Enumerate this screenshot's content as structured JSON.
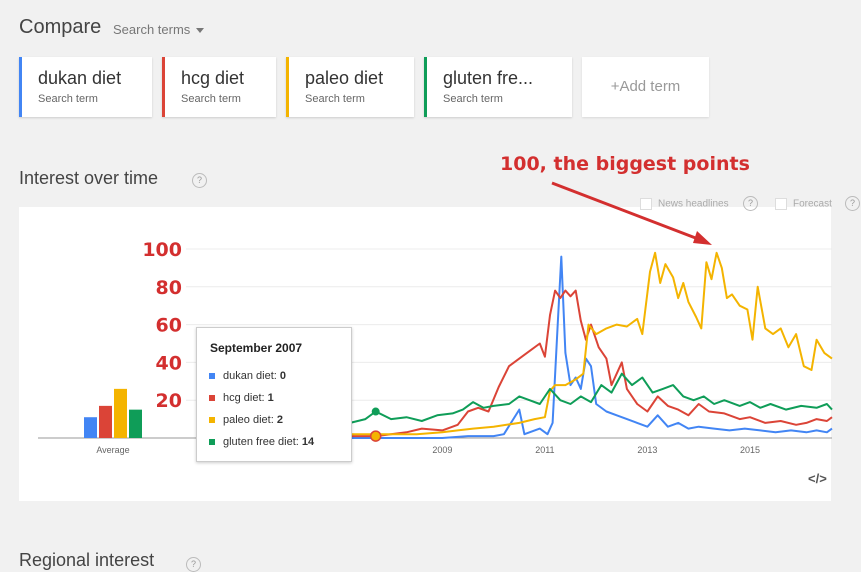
{
  "header": {
    "title": "Compare",
    "search_terms_label": "Search terms"
  },
  "terms": [
    {
      "name": "dukan diet",
      "sub": "Search term",
      "color": "#4285f4"
    },
    {
      "name": "hcg diet",
      "sub": "Search term",
      "color": "#db4437"
    },
    {
      "name": "paleo diet",
      "sub": "Search term",
      "color": "#f4b400"
    },
    {
      "name": "gluten fre...",
      "sub": "Search term",
      "color": "#0f9d58"
    }
  ],
  "add_term_label": "+Add term",
  "section": {
    "title": "Interest over time",
    "help": "?"
  },
  "options": {
    "news_headlines": "News headlines",
    "forecast": "Forecast",
    "help": "?"
  },
  "annotation": {
    "text": "100, the biggest points",
    "color": "#d32f2f"
  },
  "regional": {
    "title": "Regional interest",
    "help": "?"
  },
  "embed_icon": "</>",
  "tooltip": {
    "title": "September 2007",
    "rows": [
      {
        "label": "dukan diet: ",
        "value": "0"
      },
      {
        "label": "hcg diet: ",
        "value": "1"
      },
      {
        "label": "paleo diet: ",
        "value": "2"
      },
      {
        "label": "gluten free diet: ",
        "value": "14"
      }
    ]
  },
  "chart_data": {
    "type": "line",
    "ylim": [
      0,
      100
    ],
    "xlim": [
      2004,
      2016.6
    ],
    "xticks": [
      2009,
      2011,
      2013,
      2015
    ],
    "ytick_labels": [
      "100",
      "80",
      "60",
      "40",
      "20"
    ],
    "yticks": [
      100,
      80,
      60,
      40,
      20
    ],
    "average_label": "Average",
    "averages": [
      {
        "name": "dukan diet",
        "value": 11
      },
      {
        "name": "hcg diet",
        "value": 17
      },
      {
        "name": "paleo diet",
        "value": 26
      },
      {
        "name": "gluten free diet",
        "value": 15
      }
    ],
    "series": [
      {
        "name": "dukan diet",
        "color": "#4285f4",
        "points": [
          [
            2004.9,
            1
          ],
          [
            2005.5,
            1
          ],
          [
            2006,
            0
          ],
          [
            2007,
            0
          ],
          [
            2007.7,
            0
          ],
          [
            2008.5,
            0
          ],
          [
            2009,
            0
          ],
          [
            2009.5,
            1
          ],
          [
            2010,
            1
          ],
          [
            2010.2,
            2
          ],
          [
            2010.5,
            15
          ],
          [
            2010.6,
            2
          ],
          [
            2010.9,
            5
          ],
          [
            2011.05,
            2
          ],
          [
            2011.15,
            8
          ],
          [
            2011.25,
            60
          ],
          [
            2011.32,
            96
          ],
          [
            2011.4,
            45
          ],
          [
            2011.5,
            28
          ],
          [
            2011.6,
            32
          ],
          [
            2011.7,
            26
          ],
          [
            2011.8,
            42
          ],
          [
            2011.9,
            38
          ],
          [
            2012,
            18
          ],
          [
            2012.2,
            14
          ],
          [
            2012.4,
            12
          ],
          [
            2012.6,
            10
          ],
          [
            2012.8,
            8
          ],
          [
            2013,
            6
          ],
          [
            2013.2,
            12
          ],
          [
            2013.4,
            6
          ],
          [
            2013.6,
            8
          ],
          [
            2013.8,
            5
          ],
          [
            2014,
            6
          ],
          [
            2014.3,
            5
          ],
          [
            2014.6,
            4
          ],
          [
            2014.9,
            5
          ],
          [
            2015.2,
            4
          ],
          [
            2015.5,
            3
          ],
          [
            2015.8,
            4
          ],
          [
            2016.1,
            3
          ],
          [
            2016.3,
            4
          ],
          [
            2016.5,
            3
          ],
          [
            2016.6,
            5
          ]
        ]
      },
      {
        "name": "hcg diet",
        "color": "#db4437",
        "points": [
          [
            2004.9,
            2
          ],
          [
            2005.5,
            2
          ],
          [
            2006,
            1
          ],
          [
            2007,
            1
          ],
          [
            2007.7,
            1
          ],
          [
            2008.3,
            3
          ],
          [
            2008.6,
            5
          ],
          [
            2009,
            4
          ],
          [
            2009.3,
            7
          ],
          [
            2009.5,
            14
          ],
          [
            2009.7,
            16
          ],
          [
            2009.9,
            14
          ],
          [
            2010.1,
            27
          ],
          [
            2010.3,
            38
          ],
          [
            2010.5,
            42
          ],
          [
            2010.7,
            46
          ],
          [
            2010.9,
            50
          ],
          [
            2011,
            43
          ],
          [
            2011.1,
            65
          ],
          [
            2011.2,
            78
          ],
          [
            2011.3,
            74
          ],
          [
            2011.4,
            78
          ],
          [
            2011.5,
            75
          ],
          [
            2011.6,
            78
          ],
          [
            2011.7,
            62
          ],
          [
            2011.8,
            52
          ],
          [
            2011.9,
            60
          ],
          [
            2012.05,
            48
          ],
          [
            2012.2,
            42
          ],
          [
            2012.3,
            28
          ],
          [
            2012.5,
            40
          ],
          [
            2012.6,
            26
          ],
          [
            2012.8,
            18
          ],
          [
            2013,
            14
          ],
          [
            2013.2,
            22
          ],
          [
            2013.4,
            17
          ],
          [
            2013.6,
            15
          ],
          [
            2013.8,
            12
          ],
          [
            2014,
            18
          ],
          [
            2014.2,
            14
          ],
          [
            2014.5,
            13
          ],
          [
            2014.8,
            10
          ],
          [
            2015,
            11
          ],
          [
            2015.3,
            8
          ],
          [
            2015.6,
            9
          ],
          [
            2015.9,
            7
          ],
          [
            2016.1,
            8
          ],
          [
            2016.3,
            10
          ],
          [
            2016.5,
            9
          ],
          [
            2016.6,
            11
          ]
        ]
      },
      {
        "name": "paleo diet",
        "color": "#f4b400",
        "points": [
          [
            2004.9,
            1
          ],
          [
            2005.5,
            1
          ],
          [
            2006,
            1
          ],
          [
            2007,
            2
          ],
          [
            2007.7,
            2
          ],
          [
            2008.5,
            2
          ],
          [
            2009,
            3
          ],
          [
            2009.3,
            4
          ],
          [
            2009.6,
            5
          ],
          [
            2010,
            6
          ],
          [
            2010.5,
            8
          ],
          [
            2010.8,
            10
          ],
          [
            2011,
            11
          ],
          [
            2011.1,
            25
          ],
          [
            2011.2,
            28
          ],
          [
            2011.4,
            28
          ],
          [
            2011.6,
            31
          ],
          [
            2011.75,
            34
          ],
          [
            2011.85,
            60
          ],
          [
            2012,
            55
          ],
          [
            2012.2,
            58
          ],
          [
            2012.4,
            60
          ],
          [
            2012.6,
            59
          ],
          [
            2012.8,
            63
          ],
          [
            2012.9,
            55
          ],
          [
            2013.05,
            88
          ],
          [
            2013.15,
            98
          ],
          [
            2013.25,
            82
          ],
          [
            2013.35,
            92
          ],
          [
            2013.5,
            85
          ],
          [
            2013.6,
            74
          ],
          [
            2013.7,
            82
          ],
          [
            2013.8,
            72
          ],
          [
            2013.95,
            64
          ],
          [
            2014.05,
            58
          ],
          [
            2014.15,
            93
          ],
          [
            2014.25,
            84
          ],
          [
            2014.35,
            98
          ],
          [
            2014.45,
            90
          ],
          [
            2014.55,
            74
          ],
          [
            2014.65,
            76
          ],
          [
            2014.8,
            70
          ],
          [
            2014.95,
            68
          ],
          [
            2015.05,
            52
          ],
          [
            2015.15,
            80
          ],
          [
            2015.3,
            58
          ],
          [
            2015.45,
            55
          ],
          [
            2015.6,
            58
          ],
          [
            2015.75,
            48
          ],
          [
            2015.9,
            55
          ],
          [
            2016.05,
            38
          ],
          [
            2016.2,
            36
          ],
          [
            2016.3,
            52
          ],
          [
            2016.45,
            45
          ],
          [
            2016.6,
            42
          ]
        ]
      },
      {
        "name": "gluten free diet",
        "color": "#0f9d58",
        "points": [
          [
            2004.9,
            6
          ],
          [
            2005.2,
            5
          ],
          [
            2005.5,
            4
          ],
          [
            2006,
            5
          ],
          [
            2006.4,
            6
          ],
          [
            2006.8,
            7
          ],
          [
            2007.2,
            8
          ],
          [
            2007.5,
            10
          ],
          [
            2007.7,
            14
          ],
          [
            2008,
            10
          ],
          [
            2008.3,
            11
          ],
          [
            2008.6,
            9
          ],
          [
            2008.9,
            12
          ],
          [
            2009.2,
            13
          ],
          [
            2009.4,
            15
          ],
          [
            2009.6,
            19
          ],
          [
            2009.8,
            16
          ],
          [
            2010,
            17
          ],
          [
            2010.3,
            18
          ],
          [
            2010.5,
            22
          ],
          [
            2010.7,
            20
          ],
          [
            2010.9,
            18
          ],
          [
            2011.1,
            26
          ],
          [
            2011.3,
            20
          ],
          [
            2011.5,
            18
          ],
          [
            2011.7,
            22
          ],
          [
            2011.9,
            19
          ],
          [
            2012.1,
            28
          ],
          [
            2012.3,
            24
          ],
          [
            2012.5,
            34
          ],
          [
            2012.7,
            28
          ],
          [
            2012.9,
            32
          ],
          [
            2013.1,
            24
          ],
          [
            2013.3,
            26
          ],
          [
            2013.5,
            28
          ],
          [
            2013.7,
            22
          ],
          [
            2013.9,
            20
          ],
          [
            2014.1,
            22
          ],
          [
            2014.3,
            18
          ],
          [
            2014.5,
            20
          ],
          [
            2014.8,
            17
          ],
          [
            2015,
            19
          ],
          [
            2015.2,
            16
          ],
          [
            2015.4,
            18
          ],
          [
            2015.7,
            15
          ],
          [
            2016,
            17
          ],
          [
            2016.3,
            16
          ],
          [
            2016.5,
            18
          ],
          [
            2016.6,
            15
          ]
        ]
      }
    ]
  }
}
